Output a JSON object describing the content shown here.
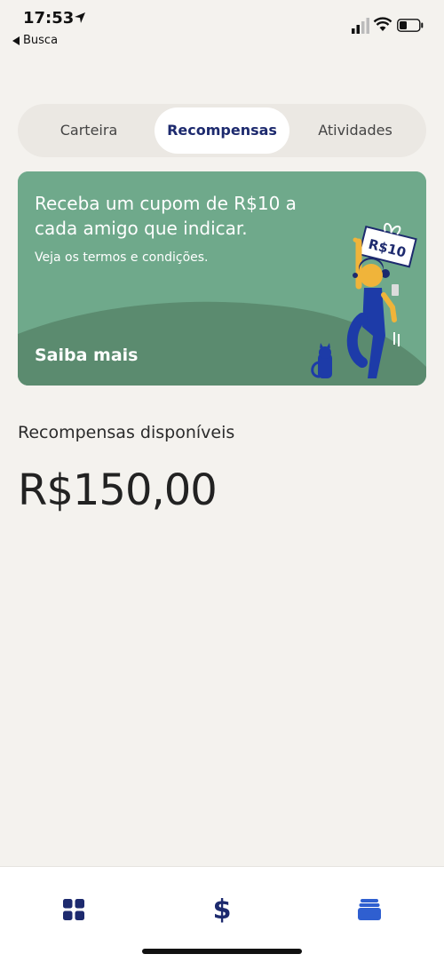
{
  "status_bar": {
    "time": "17:53",
    "back_label": "Busca"
  },
  "tabs": [
    {
      "label": "Carteira",
      "selected": false
    },
    {
      "label": "Recompensas",
      "selected": true
    },
    {
      "label": "Atividades",
      "selected": false
    }
  ],
  "promo": {
    "title": "Receba um cupom de R$10 a cada amigo que indicar.",
    "subtitle": "Veja os termos e condições.",
    "cta": "Saiba mais",
    "coupon_text": "R$10"
  },
  "rewards": {
    "label": "Recompensas disponíveis",
    "amount": "R$150,00"
  },
  "bottom_nav": [
    {
      "icon": "grid-icon"
    },
    {
      "icon": "dollar-icon"
    },
    {
      "icon": "wallet-icon"
    }
  ],
  "colors": {
    "background": "#f4f2ee",
    "accent": "#1d2a6e",
    "promo_green": "#6fa98b",
    "wallet_blue": "#2f5fd0"
  }
}
